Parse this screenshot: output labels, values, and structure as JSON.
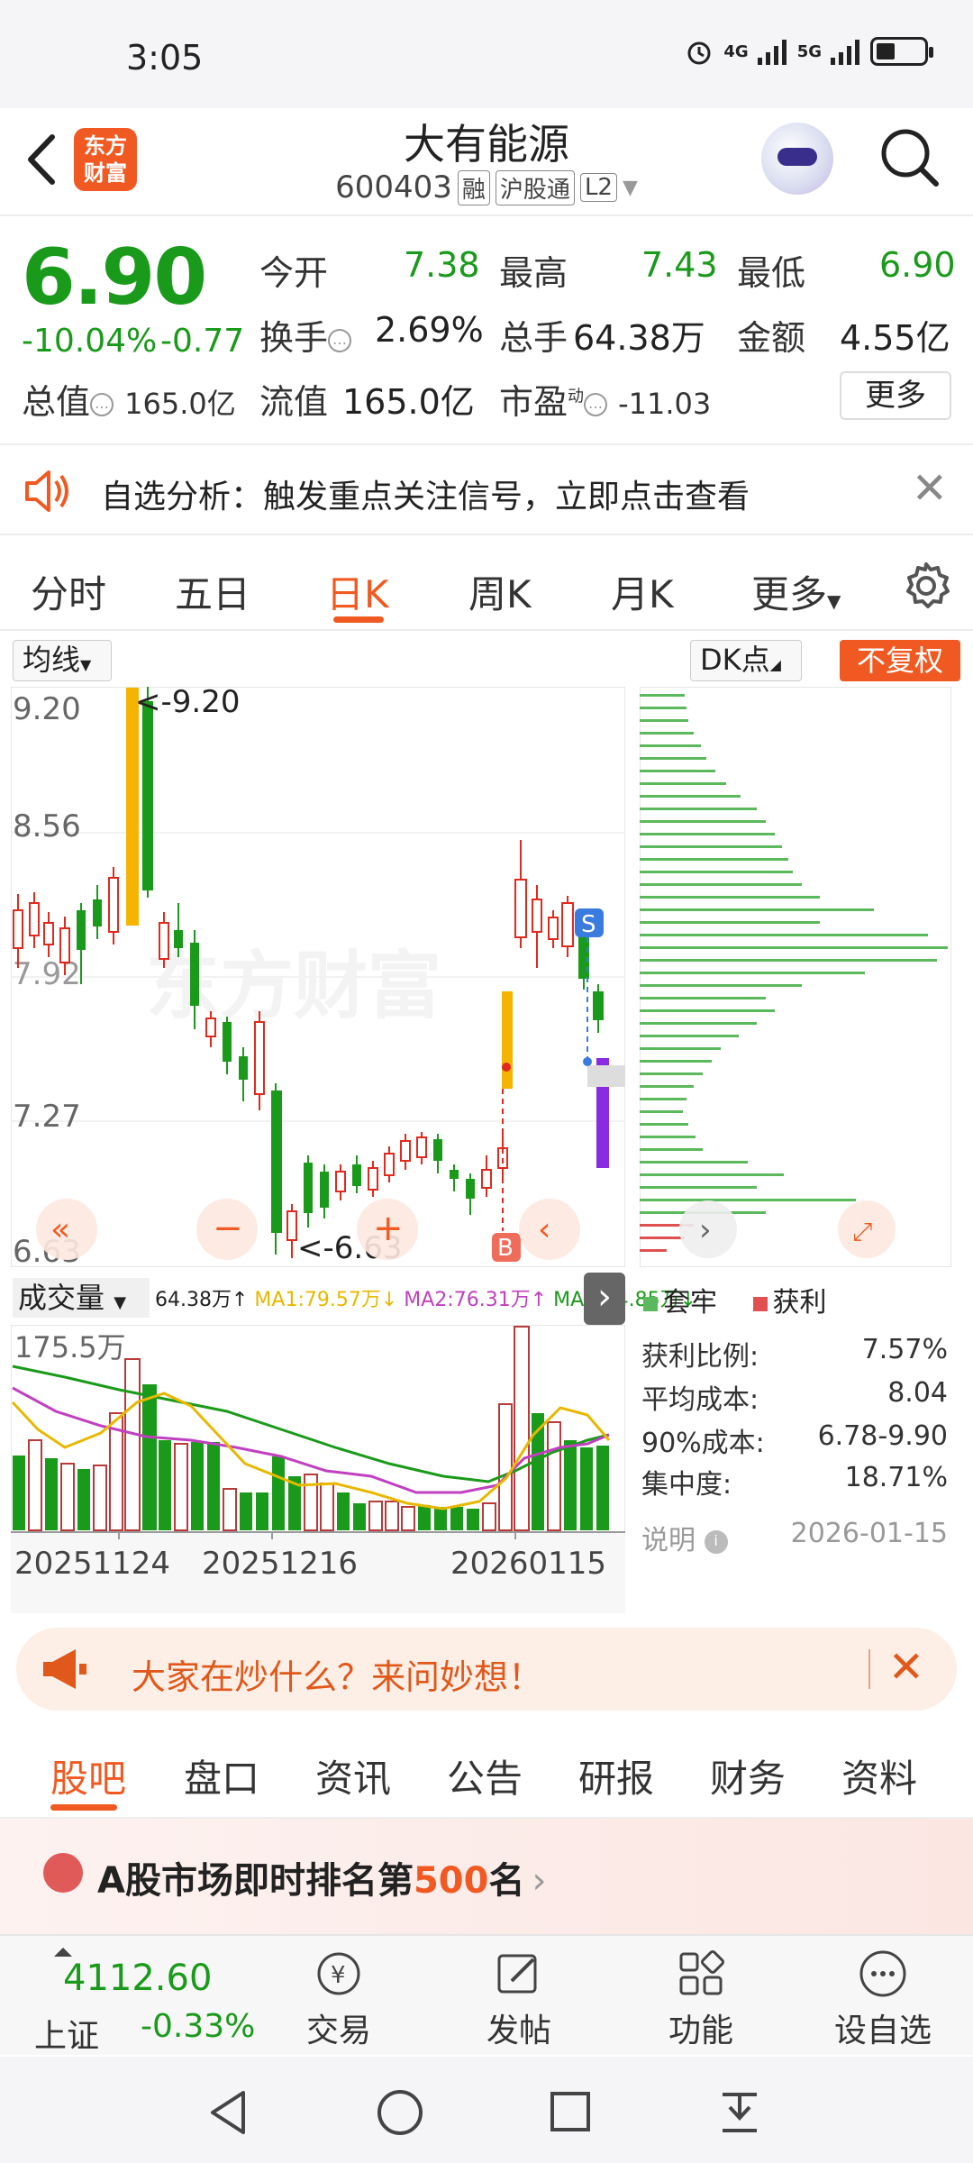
{
  "status_bar": {
    "time": "3:05",
    "signal1": "4G",
    "signal2": "5G"
  },
  "header": {
    "back_icon": "back-arrow-icon",
    "logo_text": "东方财富",
    "stock_name": "大有能源",
    "stock_code": "600403",
    "tags": [
      "融",
      "沪股通",
      "L2"
    ]
  },
  "quote": {
    "price": "6.90",
    "pct_change": "-10.04%",
    "change": "-0.77",
    "open_label": "今开",
    "open": "7.38",
    "high_label": "最高",
    "high": "7.43",
    "low_label": "最低",
    "low": "6.90",
    "turnover_label": "换手",
    "turnover": "2.69%",
    "volume_label": "总手",
    "volume": "64.38万",
    "amount_label": "金额",
    "amount": "4.55亿",
    "mktcap_label": "总值",
    "mktcap": "165.0亿",
    "float_label": "流值",
    "float": "165.0亿",
    "pe_label": "市盈",
    "pe_sup": "动",
    "pe": "-11.03",
    "more": "更多"
  },
  "alert": {
    "text": "自选分析：触发重点关注信号，立即点击查看"
  },
  "chart_tabs": {
    "items": [
      "分时",
      "五日",
      "日K",
      "周K",
      "月K",
      "更多"
    ],
    "active": "日K"
  },
  "chart_toolbar": {
    "ma": "均线",
    "dk": "DK点",
    "fq": "不复权"
  },
  "kline": {
    "y_labels": [
      "9.20",
      "8.56",
      "7.92",
      "7.27",
      "6.63"
    ],
    "max_label": "<-9.20",
    "min_label": "<-6.63",
    "signal_s": "S",
    "signal_b": "B",
    "watermark": "东方财富"
  },
  "volume": {
    "select": "成交量",
    "vol_text": "64.38万↑",
    "ma1": "MA1:79.57万↓",
    "ma2": "MA2:76.31万↑",
    "ma3": "MA3:54.85万↓",
    "y_label": "175.5万",
    "x_labels": [
      "20251124",
      "20251216",
      "20260115"
    ]
  },
  "chips": {
    "legend_trapped": "套牢",
    "legend_profit": "获利",
    "profit_ratio_label": "获利比例:",
    "profit_ratio": "7.57%",
    "avg_cost_label": "平均成本:",
    "avg_cost": "8.04",
    "cost90_label": "90%成本:",
    "cost90": "6.78-9.90",
    "concentration_label": "集中度:",
    "concentration": "18.71%",
    "explain": "说明",
    "date": "2026-01-15"
  },
  "ad": {
    "text": "大家在炒什么？来问妙想！"
  },
  "sub_tabs": {
    "items": [
      "股吧",
      "盘口",
      "资讯",
      "公告",
      "研报",
      "财务",
      "资料"
    ],
    "active": "股吧"
  },
  "rank": {
    "prefix": "A股市场即时排名第",
    "num": "500",
    "suffix": "名"
  },
  "bottom_nav": {
    "index_value": "4112.60",
    "index_name": "上证",
    "index_change": "-0.33%",
    "items": [
      "交易",
      "发帖",
      "功能",
      "设自选"
    ]
  },
  "colors": {
    "accent": "#f05a22",
    "down": "#1a9a1a",
    "up": "#e02a1d"
  }
}
